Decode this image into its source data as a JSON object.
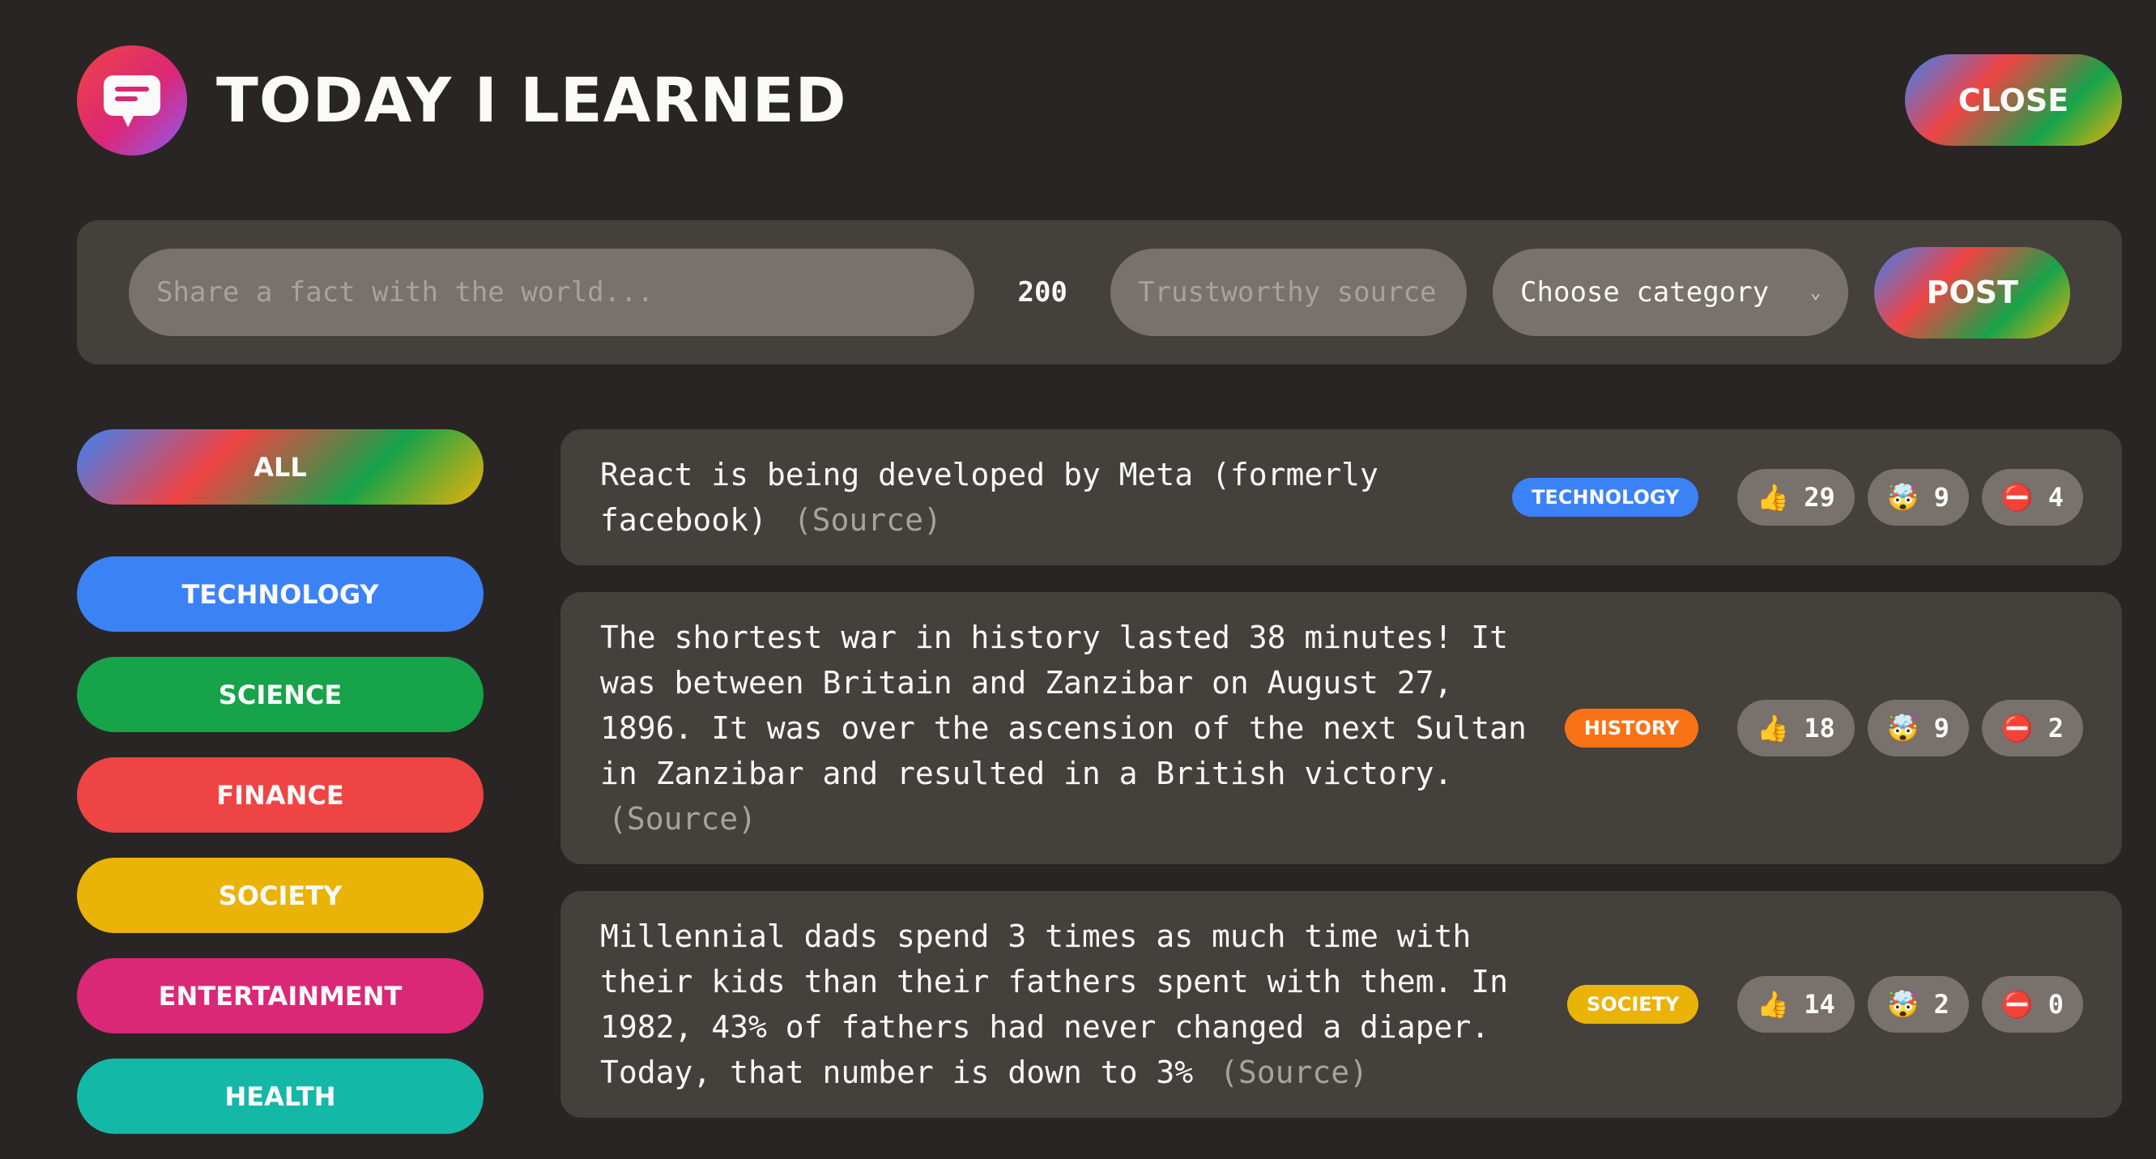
{
  "header": {
    "title": "Today I Learned",
    "close_label": "Close"
  },
  "form": {
    "fact_placeholder": "Share a fact with the world...",
    "char_count": "200",
    "source_placeholder": "Trustworthy source...",
    "category_select": "Choose category",
    "post_label": "Post"
  },
  "sidebar": {
    "all_label": "All",
    "categories": [
      {
        "label": "Technology",
        "color": "#3b82f6"
      },
      {
        "label": "Science",
        "color": "#16a34a"
      },
      {
        "label": "Finance",
        "color": "#ef4444"
      },
      {
        "label": "Society",
        "color": "#eab308"
      },
      {
        "label": "Entertainment",
        "color": "#db2777"
      },
      {
        "label": "Health",
        "color": "#14b8a6"
      }
    ]
  },
  "facts": [
    {
      "text": "React is being developed by Meta (formerly facebook)",
      "source_label": "(Source)",
      "category": "Technology",
      "category_color": "#3b82f6",
      "votes_interesting": "29",
      "votes_mindblowing": "9",
      "votes_false": "4"
    },
    {
      "text": "The shortest war in history lasted 38 minutes! It was between Britain and Zanzibar on August 27, 1896. It was over the ascension of the next Sultan in Zanzibar and resulted in a British victory.",
      "source_label": "(Source)",
      "category": "History",
      "category_color": "#f97316",
      "votes_interesting": "18",
      "votes_mindblowing": "9",
      "votes_false": "2"
    },
    {
      "text": "Millennial dads spend 3 times as much time with their kids than their fathers spent with them. In 1982, 43% of fathers had never changed a diaper. Today, that number is down to 3%",
      "source_label": "(Source)",
      "category": "Society",
      "category_color": "#eab308",
      "votes_interesting": "14",
      "votes_mindblowing": "2",
      "votes_false": "0"
    }
  ],
  "icons": {
    "logo": "speech-bubble-icon",
    "interesting": "👍",
    "mindblowing": "🤯",
    "false": "⛔️",
    "chevron": "⌄"
  }
}
